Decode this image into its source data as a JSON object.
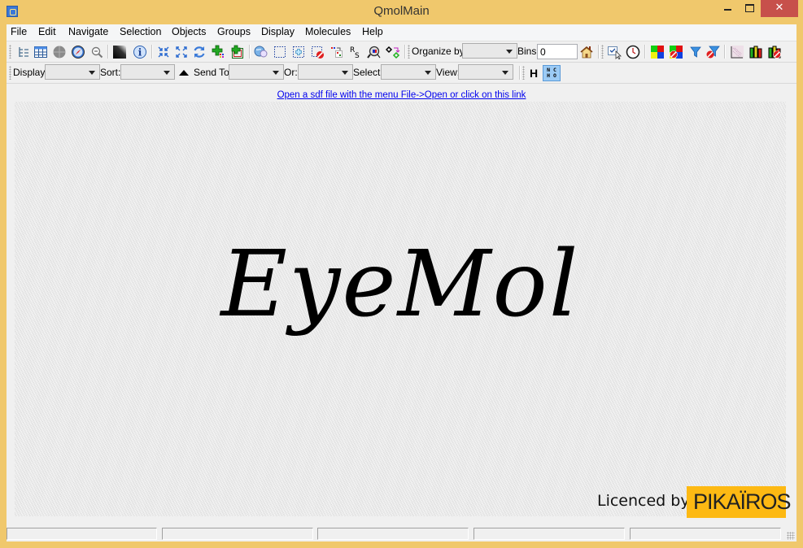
{
  "window": {
    "title": "QmolMain",
    "controls": {
      "minimize": "minimize",
      "maximize": "maximize",
      "close": "✕"
    }
  },
  "menu": [
    "File",
    "Edit",
    "Navigate",
    "Selection",
    "Objects",
    "Groups",
    "Display",
    "Molecules",
    "Help"
  ],
  "toolbar1": {
    "icons": [
      "tree-view-icon",
      "table-view-icon",
      "gray-circle-icon",
      "compass-icon",
      "zoom-icon",
      "gradient-icon",
      "info-icon",
      "shrink-icon",
      "expand-icon",
      "refresh-icon",
      "add-colored-icon",
      "add-framed-icon",
      "globe-search-icon",
      "select-rect-icon",
      "select-add-icon",
      "select-remove-icon",
      "move-selection-icon",
      "rs-icon",
      "inspect-icon",
      "molecule-transform-icon"
    ],
    "organize_label": "Organize by:",
    "organize_value": "",
    "bins_label": "Bins:",
    "bins_value": "0",
    "right_icons": [
      "home-icon",
      "select-pointer-icon",
      "clock-icon",
      "color-grid-icon",
      "color-grid-clear-icon",
      "filter-icon",
      "filter-clear-icon",
      "scatter-icon",
      "bar-chart-icon",
      "bar-chart-clear-icon"
    ],
    "rs_text": "R",
    "rs_sub": "S"
  },
  "toolbar2": {
    "display_label": "Display:",
    "display_value": "",
    "sort_label": "Sort:",
    "sort_value": "",
    "send_to_label": "Send To:",
    "send_to_value": "",
    "or_label": "Or:",
    "or_value": "",
    "select_label": "Select:",
    "select_value": "",
    "view_label": "View:",
    "view_value": "",
    "h_button": "H",
    "ncho_top": "N C",
    "ncho_bottom": "H O"
  },
  "main": {
    "open_link": "Open a sdf file with the menu File->Open or click on this link ",
    "logo_text": "EyeMol",
    "licence_text": "Licenced by",
    "brand_text": "PIKAÏROS",
    "brand_color": "#fdb913"
  },
  "statusbar": {
    "panes": [
      "",
      "",
      "",
      "",
      ""
    ]
  }
}
